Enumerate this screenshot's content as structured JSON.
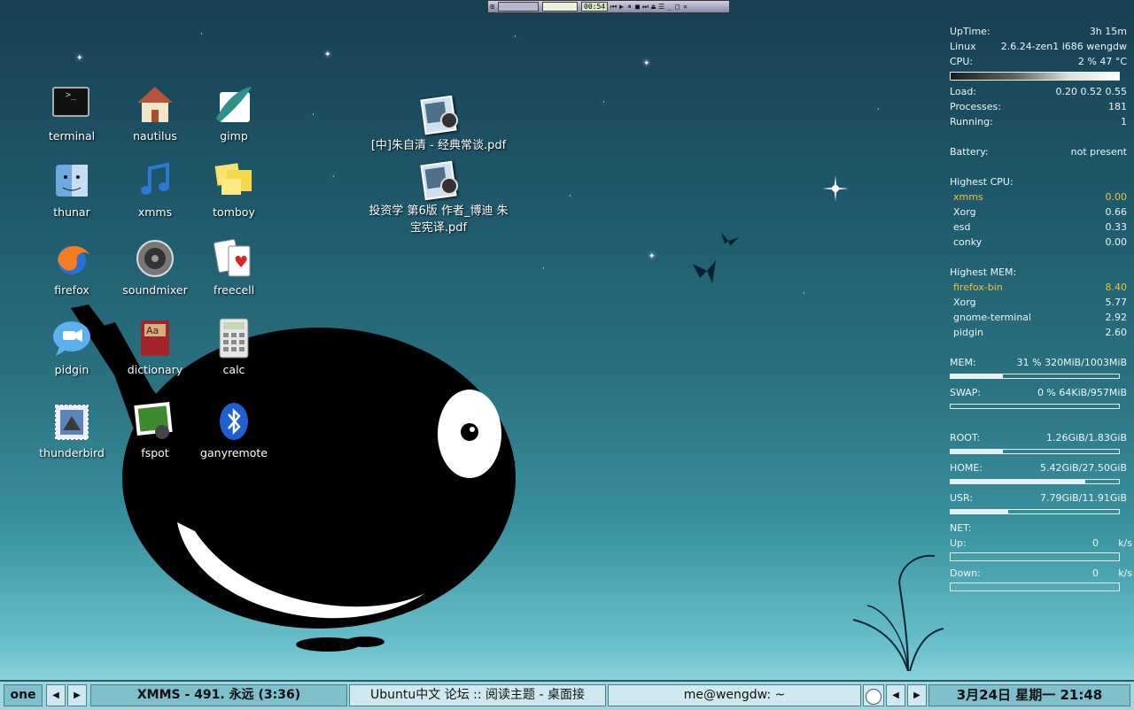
{
  "desktop_icons": [
    {
      "id": "terminal",
      "label": "terminal",
      "icon": "terminal-icon"
    },
    {
      "id": "nautilus",
      "label": "nautilus",
      "icon": "home-folder-icon"
    },
    {
      "id": "gimp",
      "label": "gimp",
      "icon": "gimp-brush-icon"
    },
    {
      "id": "thunar",
      "label": "thunar",
      "icon": "finder-face-icon"
    },
    {
      "id": "xmms",
      "label": "xmms",
      "icon": "music-note-icon"
    },
    {
      "id": "tomboy",
      "label": "tomboy",
      "icon": "sticky-notes-icon"
    },
    {
      "id": "firefox",
      "label": "firefox",
      "icon": "firefox-icon"
    },
    {
      "id": "soundmixer",
      "label": "soundmixer",
      "icon": "speaker-icon"
    },
    {
      "id": "freecell",
      "label": "freecell",
      "icon": "playing-cards-icon"
    },
    {
      "id": "pidgin",
      "label": "pidgin",
      "icon": "chat-bubble-icon"
    },
    {
      "id": "dictionary",
      "label": "dictionary",
      "icon": "dictionary-book-icon"
    },
    {
      "id": "calc",
      "label": "calc",
      "icon": "calculator-icon"
    },
    {
      "id": "thunderbird",
      "label": "thunderbird",
      "icon": "mail-stamp-icon"
    },
    {
      "id": "fspot",
      "label": "fspot",
      "icon": "photo-icon"
    },
    {
      "id": "ganyremote",
      "label": "ganyremote",
      "icon": "bluetooth-icon"
    }
  ],
  "files": [
    {
      "line1": "[中]朱自清 - 经典常谈.pdf",
      "line2": "",
      "icon": "preview-pdf-icon"
    },
    {
      "line1": "投资学 第6版 作者_博迪 朱",
      "line2": "宝宪译.pdf",
      "icon": "preview-pdf-icon"
    }
  ],
  "xmms_mini": {
    "time": "00:54"
  },
  "conky": {
    "uptime_label": "UpTime:",
    "uptime": "3h 15m",
    "os_label": "Linux",
    "kernel": "2.6.24-zen1 i686 wengdw",
    "cpu_label": "CPU:",
    "cpu": "2 % 47 °C",
    "load_label": "Load:",
    "load": "0.20 0.52 0.55",
    "processes_label": "Processes:",
    "processes": "181",
    "running_label": "Running:",
    "running": "1",
    "battery_label": "Battery:",
    "battery": "not present",
    "highest_cpu_label": "Highest CPU:",
    "highest_cpu": [
      {
        "name": "xmms",
        "value": "0.00"
      },
      {
        "name": "Xorg",
        "value": "0.66"
      },
      {
        "name": "esd",
        "value": "0.33"
      },
      {
        "name": "conky",
        "value": "0.00"
      }
    ],
    "highest_mem_label": "Highest MEM:",
    "highest_mem": [
      {
        "name": "firefox-bin",
        "value": "8.40"
      },
      {
        "name": "Xorg",
        "value": "5.77"
      },
      {
        "name": "gnome-terminal",
        "value": "2.92"
      },
      {
        "name": "pidgin",
        "value": "2.60"
      }
    ],
    "mem_label": "MEM:",
    "mem": "31 % 320MiB/1003MiB",
    "mem_fraction": 0.31,
    "swap_label": "SWAP:",
    "swap": "0 % 64KiB/957MiB",
    "swap_fraction": 0.0,
    "root_label": "ROOT:",
    "root": "1.26GiB/1.83GiB",
    "root_fraction": 0.31,
    "home_label": "HOME:",
    "home": "5.42GiB/27.50GiB",
    "home_fraction": 0.8,
    "usr_label": "USR:",
    "usr": "7.79GiB/11.91GiB",
    "usr_fraction": 0.34,
    "net_label": "NET:",
    "up_label": "Up:",
    "up": "0",
    "up_unit": "k/s",
    "down_label": "Down:",
    "down": "0",
    "down_unit": "k/s"
  },
  "taskbar": {
    "workspace": "one",
    "prev_icon": "triangle-left-icon",
    "next_icon": "triangle-right-icon",
    "tasks": [
      {
        "title": "XMMS - 491. 永远 (3:36)"
      },
      {
        "title": "Ubuntu中文 论坛 :: 阅读主题 - 桌面接"
      },
      {
        "title": "me@wengdw: ~"
      }
    ],
    "clock": "3月24日 星期一 21:48"
  }
}
